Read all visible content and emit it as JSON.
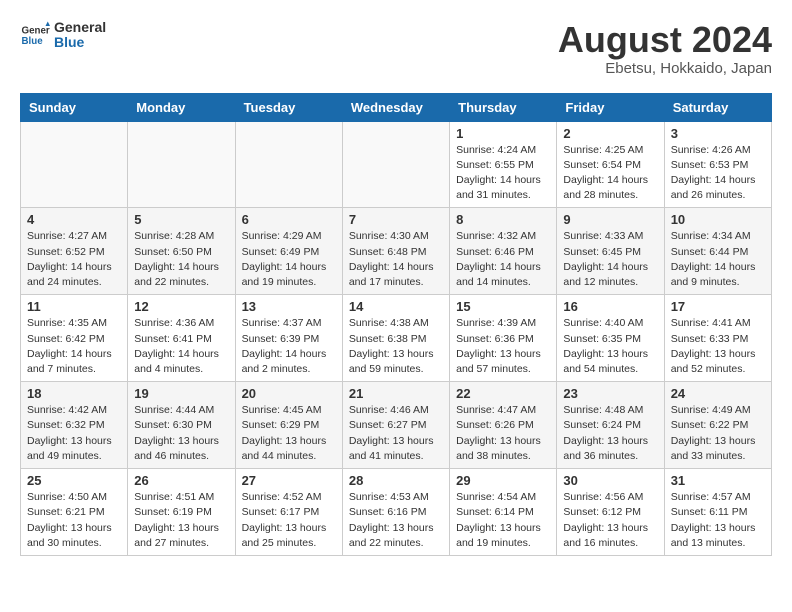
{
  "header": {
    "logo_general": "General",
    "logo_blue": "Blue",
    "month_year": "August 2024",
    "location": "Ebetsu, Hokkaido, Japan"
  },
  "weekdays": [
    "Sunday",
    "Monday",
    "Tuesday",
    "Wednesday",
    "Thursday",
    "Friday",
    "Saturday"
  ],
  "weeks": [
    [
      {
        "day": "",
        "info": ""
      },
      {
        "day": "",
        "info": ""
      },
      {
        "day": "",
        "info": ""
      },
      {
        "day": "",
        "info": ""
      },
      {
        "day": "1",
        "info": "Sunrise: 4:24 AM\nSunset: 6:55 PM\nDaylight: 14 hours\nand 31 minutes."
      },
      {
        "day": "2",
        "info": "Sunrise: 4:25 AM\nSunset: 6:54 PM\nDaylight: 14 hours\nand 28 minutes."
      },
      {
        "day": "3",
        "info": "Sunrise: 4:26 AM\nSunset: 6:53 PM\nDaylight: 14 hours\nand 26 minutes."
      }
    ],
    [
      {
        "day": "4",
        "info": "Sunrise: 4:27 AM\nSunset: 6:52 PM\nDaylight: 14 hours\nand 24 minutes."
      },
      {
        "day": "5",
        "info": "Sunrise: 4:28 AM\nSunset: 6:50 PM\nDaylight: 14 hours\nand 22 minutes."
      },
      {
        "day": "6",
        "info": "Sunrise: 4:29 AM\nSunset: 6:49 PM\nDaylight: 14 hours\nand 19 minutes."
      },
      {
        "day": "7",
        "info": "Sunrise: 4:30 AM\nSunset: 6:48 PM\nDaylight: 14 hours\nand 17 minutes."
      },
      {
        "day": "8",
        "info": "Sunrise: 4:32 AM\nSunset: 6:46 PM\nDaylight: 14 hours\nand 14 minutes."
      },
      {
        "day": "9",
        "info": "Sunrise: 4:33 AM\nSunset: 6:45 PM\nDaylight: 14 hours\nand 12 minutes."
      },
      {
        "day": "10",
        "info": "Sunrise: 4:34 AM\nSunset: 6:44 PM\nDaylight: 14 hours\nand 9 minutes."
      }
    ],
    [
      {
        "day": "11",
        "info": "Sunrise: 4:35 AM\nSunset: 6:42 PM\nDaylight: 14 hours\nand 7 minutes."
      },
      {
        "day": "12",
        "info": "Sunrise: 4:36 AM\nSunset: 6:41 PM\nDaylight: 14 hours\nand 4 minutes."
      },
      {
        "day": "13",
        "info": "Sunrise: 4:37 AM\nSunset: 6:39 PM\nDaylight: 14 hours\nand 2 minutes."
      },
      {
        "day": "14",
        "info": "Sunrise: 4:38 AM\nSunset: 6:38 PM\nDaylight: 13 hours\nand 59 minutes."
      },
      {
        "day": "15",
        "info": "Sunrise: 4:39 AM\nSunset: 6:36 PM\nDaylight: 13 hours\nand 57 minutes."
      },
      {
        "day": "16",
        "info": "Sunrise: 4:40 AM\nSunset: 6:35 PM\nDaylight: 13 hours\nand 54 minutes."
      },
      {
        "day": "17",
        "info": "Sunrise: 4:41 AM\nSunset: 6:33 PM\nDaylight: 13 hours\nand 52 minutes."
      }
    ],
    [
      {
        "day": "18",
        "info": "Sunrise: 4:42 AM\nSunset: 6:32 PM\nDaylight: 13 hours\nand 49 minutes."
      },
      {
        "day": "19",
        "info": "Sunrise: 4:44 AM\nSunset: 6:30 PM\nDaylight: 13 hours\nand 46 minutes."
      },
      {
        "day": "20",
        "info": "Sunrise: 4:45 AM\nSunset: 6:29 PM\nDaylight: 13 hours\nand 44 minutes."
      },
      {
        "day": "21",
        "info": "Sunrise: 4:46 AM\nSunset: 6:27 PM\nDaylight: 13 hours\nand 41 minutes."
      },
      {
        "day": "22",
        "info": "Sunrise: 4:47 AM\nSunset: 6:26 PM\nDaylight: 13 hours\nand 38 minutes."
      },
      {
        "day": "23",
        "info": "Sunrise: 4:48 AM\nSunset: 6:24 PM\nDaylight: 13 hours\nand 36 minutes."
      },
      {
        "day": "24",
        "info": "Sunrise: 4:49 AM\nSunset: 6:22 PM\nDaylight: 13 hours\nand 33 minutes."
      }
    ],
    [
      {
        "day": "25",
        "info": "Sunrise: 4:50 AM\nSunset: 6:21 PM\nDaylight: 13 hours\nand 30 minutes."
      },
      {
        "day": "26",
        "info": "Sunrise: 4:51 AM\nSunset: 6:19 PM\nDaylight: 13 hours\nand 27 minutes."
      },
      {
        "day": "27",
        "info": "Sunrise: 4:52 AM\nSunset: 6:17 PM\nDaylight: 13 hours\nand 25 minutes."
      },
      {
        "day": "28",
        "info": "Sunrise: 4:53 AM\nSunset: 6:16 PM\nDaylight: 13 hours\nand 22 minutes."
      },
      {
        "day": "29",
        "info": "Sunrise: 4:54 AM\nSunset: 6:14 PM\nDaylight: 13 hours\nand 19 minutes."
      },
      {
        "day": "30",
        "info": "Sunrise: 4:56 AM\nSunset: 6:12 PM\nDaylight: 13 hours\nand 16 minutes."
      },
      {
        "day": "31",
        "info": "Sunrise: 4:57 AM\nSunset: 6:11 PM\nDaylight: 13 hours\nand 13 minutes."
      }
    ]
  ]
}
